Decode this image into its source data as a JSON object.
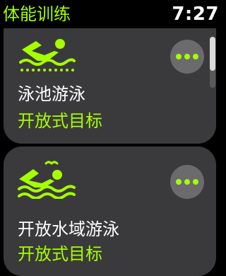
{
  "app": {
    "title": "体能训练",
    "time": "7:27"
  },
  "workouts": [
    {
      "name": "泳池游泳",
      "goal": "开放式目标",
      "icon": "pool-swim-icon"
    },
    {
      "name": "开放水域游泳",
      "goal": "开放式目标",
      "icon": "open-water-swim-icon"
    }
  ],
  "colors": {
    "accent": "#a6ff00",
    "card": "#3a3a3c",
    "more_button": "#6b6b6e",
    "background": "#000000"
  },
  "scroll_position": 0
}
